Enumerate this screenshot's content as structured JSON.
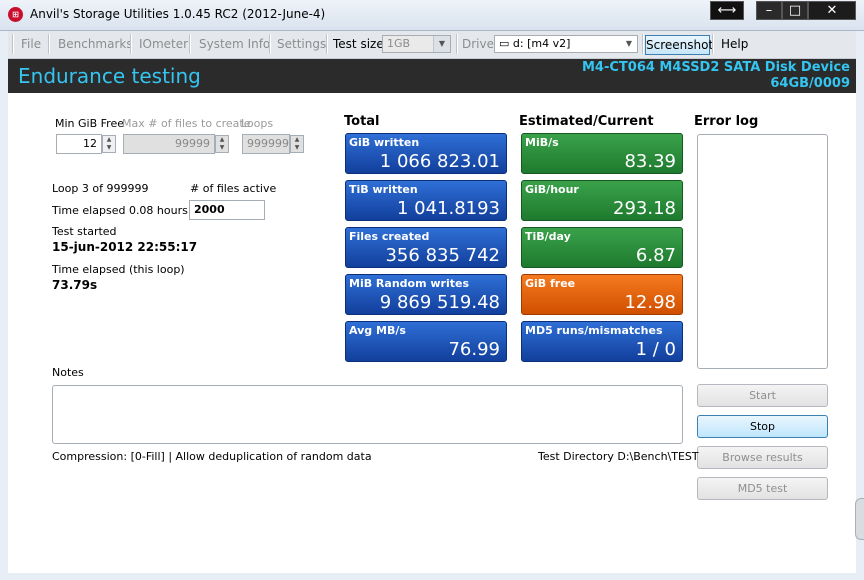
{
  "window": {
    "title": "Anvil's Storage Utilities 1.0.45 RC2 (2012-June-4)",
    "icon_glyph": "⊞"
  },
  "menubar": {
    "items": [
      "File",
      "Benchmarks",
      "IOmeter",
      "System Info",
      "Settings"
    ],
    "test_size_label": "Test size",
    "test_size_value": "1GB",
    "drive_label": "Drive",
    "drive_value": "d: [m4 v2]",
    "screenshot_label": "Screenshot",
    "help_label": "Help"
  },
  "header": {
    "title": "Endurance testing",
    "device_name": "M4-CT064 M4SSD2 SATA Disk Device",
    "device_size": "64GB/0009"
  },
  "settings": {
    "min_gib_free_label": "Min GiB Free",
    "min_gib_free_value": "12",
    "max_files_label": "Max # of files to create",
    "max_files_value": "99999",
    "loops_label": "Loops",
    "loops_value": "999999"
  },
  "status": {
    "loop_text": "Loop 3 of 999999",
    "files_active_label": "# of files active",
    "files_active_value": "2000",
    "time_elapsed_text": "Time elapsed 0.08 hours",
    "test_started_label": "Test started",
    "test_started_value": "15-jun-2012 22:55:17",
    "time_elapsed_loop_label": "Time elapsed (this loop)",
    "time_elapsed_loop_value": "73.79s"
  },
  "totals": {
    "heading": "Total",
    "tiles": [
      {
        "label": "GiB written",
        "value": "1 066 823.01"
      },
      {
        "label": "TiB written",
        "value": "1 041.8193"
      },
      {
        "label": "Files created",
        "value": "356 835 742"
      },
      {
        "label": "MiB Random writes",
        "value": "9 869 519.48"
      },
      {
        "label": "Avg MB/s",
        "value": "76.99"
      }
    ]
  },
  "estimated": {
    "heading": "Estimated/Current",
    "tiles": [
      {
        "label": "MiB/s",
        "value": "83.39"
      },
      {
        "label": "GiB/hour",
        "value": "293.18"
      },
      {
        "label": "TiB/day",
        "value": "6.87"
      },
      {
        "label": "GiB free",
        "value": "12.98"
      },
      {
        "label": "MD5 runs/mismatches",
        "value": "1 / 0"
      }
    ]
  },
  "error_log": {
    "heading": "Error log"
  },
  "notes": {
    "label": "Notes"
  },
  "footer": {
    "compression_text": "Compression: [0-Fill] | Allow deduplication of random data",
    "test_directory_text": "Test Directory D:\\Bench\\TEST"
  },
  "buttons": {
    "start": "Start",
    "stop": "Stop",
    "browse_results": "Browse results",
    "md5_test": "MD5 test"
  },
  "colors": {
    "accent_cyan": "#34c5f0",
    "tile_blue": "#1f55b8",
    "tile_green": "#2a8c3a",
    "tile_orange": "#e9650f"
  }
}
